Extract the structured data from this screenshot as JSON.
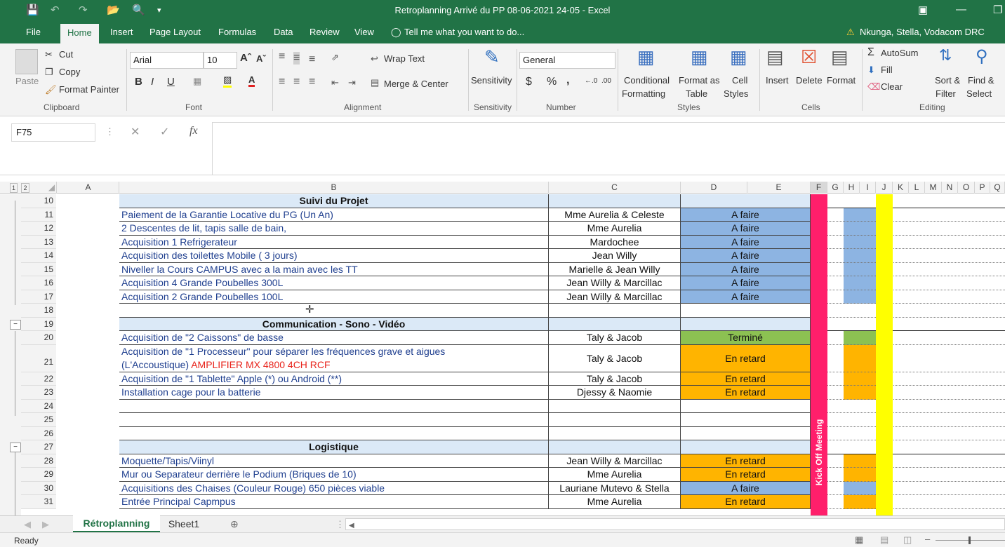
{
  "window": {
    "title": "Retroplanning Arrivé du PP 08-06-2021 24-05 - Excel"
  },
  "menu": {
    "tabs": [
      "File",
      "Home",
      "Insert",
      "Page Layout",
      "Formulas",
      "Data",
      "Review",
      "View"
    ],
    "tell_me": "Tell me what you want to do...",
    "user": "Nkunga, Stella, Vodacom DRC"
  },
  "ribbon": {
    "clipboard": {
      "paste": "Paste",
      "cut": "Cut",
      "copy": "Copy",
      "format_painter": "Format Painter",
      "group": "Clipboard"
    },
    "font": {
      "name": "Arial",
      "size": "10",
      "group": "Font"
    },
    "alignment": {
      "wrap": "Wrap Text",
      "merge": "Merge & Center",
      "group": "Alignment"
    },
    "sensitivity": {
      "label": "Sensitivity",
      "group": "Sensitivity"
    },
    "number": {
      "format": "General",
      "group": "Number"
    },
    "styles": {
      "conditional": "Conditional",
      "conditional2": "Formatting",
      "format_as": "Format as",
      "format_as2": "Table",
      "cell_styles": "Cell",
      "cell_styles2": "Styles",
      "group": "Styles"
    },
    "cells": {
      "insert": "Insert",
      "delete": "Delete",
      "format": "Format",
      "group": "Cells"
    },
    "editing": {
      "autosum": "AutoSum",
      "fill": "Fill",
      "clear": "Clear",
      "sort": "Sort &",
      "sort2": "Filter",
      "find": "Find &",
      "find2": "Select",
      "group": "Editing"
    }
  },
  "formula": {
    "name_box": "F75",
    "content": ""
  },
  "columns": [
    "A",
    "B",
    "C",
    "D",
    "E",
    "F",
    "G",
    "H",
    "I",
    "J",
    "K",
    "L",
    "M",
    "N",
    "O",
    "P",
    "Q"
  ],
  "kickoff": "Kick Off Meeting",
  "rows": [
    {
      "n": "10",
      "type": "header",
      "b": "Suivi du Projet"
    },
    {
      "n": "11",
      "b": "Paiement de la Garantie Locative du PG (Un An)",
      "c": "Mme Aurelia & Celeste",
      "d": "A faire",
      "status": "blue"
    },
    {
      "n": "12",
      "b": "2 Descentes de lit, tapis salle de bain,",
      "c": "Mme Aurelia",
      "d": "A faire",
      "status": "blue"
    },
    {
      "n": "13",
      "b": "Acquisition 1 Refrigerateur",
      "c": "Mardochee",
      "d": "A faire",
      "status": "blue"
    },
    {
      "n": "14",
      "b": "Acquisition des toilettes Mobile ( 3 jours)",
      "c": "Jean Willy",
      "d": "A faire",
      "status": "blue"
    },
    {
      "n": "15",
      "b": "Niveller la Cours CAMPUS avec a la main avec les TT",
      "c": "Marielle & Jean Willy",
      "d": "A faire",
      "status": "blue"
    },
    {
      "n": "16",
      "b": "Acquisition 4 Grande Poubelles 300L",
      "c": "Jean Willy & Marcillac",
      "d": "A faire",
      "status": "blue"
    },
    {
      "n": "17",
      "b": "Acquisition 2 Grande Poubelles 100L",
      "c": "Jean Willy & Marcillac",
      "d": "A faire",
      "status": "blue"
    },
    {
      "n": "18",
      "b": "",
      "c": "",
      "d": ""
    },
    {
      "n": "19",
      "type": "header",
      "b": "Communication - Sono - Vidéo"
    },
    {
      "n": "20",
      "b": "Acquisition de \"2 Caissons\" de basse",
      "c": "Taly & Jacob",
      "d": "Terminé",
      "status": "green"
    },
    {
      "n": "21",
      "tall": true,
      "b": "Acquisition de \"1 Processeur\" pour séparer les fréquences grave et aigues",
      "b2": "(L'Accoustique)",
      "b3": "AMPLIFIER MX 4800 4CH RCF",
      "c": "Taly & Jacob",
      "d": "En retard",
      "status": "orange"
    },
    {
      "n": "22",
      "b": "Acquisition de \"1 Tablette\" Apple (*) ou Android (**)",
      "c": "Taly & Jacob",
      "d": "En retard",
      "status": "orange"
    },
    {
      "n": "23",
      "b": "Installation cage pour la batterie",
      "c": "Djessy & Naomie",
      "d": "En retard",
      "status": "orange"
    },
    {
      "n": "24",
      "b": "",
      "c": "",
      "d": ""
    },
    {
      "n": "25",
      "b": "",
      "c": "",
      "d": ""
    },
    {
      "n": "26",
      "b": "",
      "c": "",
      "d": ""
    },
    {
      "n": "27",
      "type": "header",
      "b": "Logistique"
    },
    {
      "n": "28",
      "b": "Moquette/Tapis/Viinyl",
      "c": "Jean Willy & Marcillac",
      "d": "En retard",
      "status": "orange"
    },
    {
      "n": "29",
      "b": "Mur ou Separateur derrière le Podium (Briques de 10)",
      "c": "Mme Aurelia",
      "d": "En retard",
      "status": "orange"
    },
    {
      "n": "30",
      "b": "Acquisitions des Chaises (Couleur Rouge) 650 pièces viable",
      "c": "Lauriane Mutevo & Stella",
      "d": "A faire",
      "status": "blue"
    },
    {
      "n": "31",
      "b": "Entrée Principal Capmpus",
      "c": "Mme Aurelia",
      "d": "En retard",
      "status": "orange"
    }
  ],
  "sheets": [
    "Rétroplanning",
    "Sheet1"
  ],
  "status": {
    "ready": "Ready"
  },
  "colors": {
    "excel_green": "#217346",
    "blue": "#8db4e2",
    "green": "#8cc152",
    "orange": "#ffb400",
    "yellow": "#ffff00",
    "pink": "#ff1f6b",
    "header": "#dbe9f7"
  }
}
